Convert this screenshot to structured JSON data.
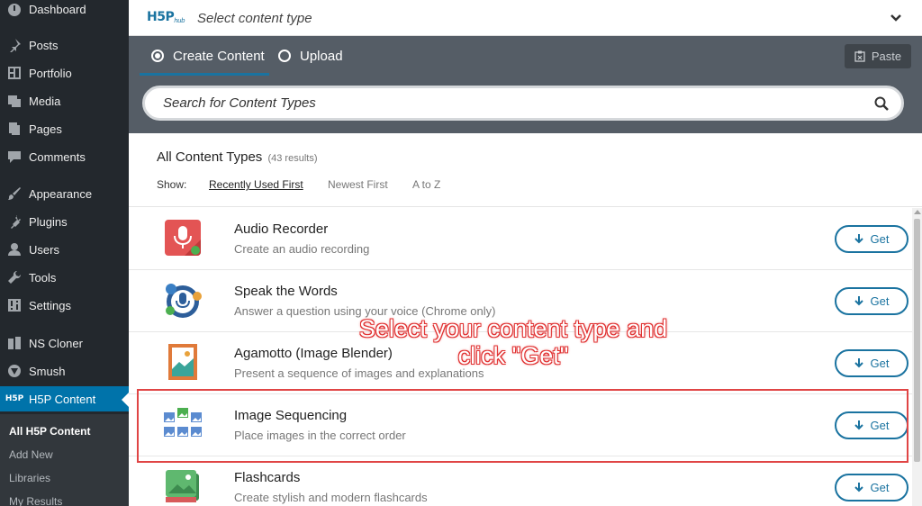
{
  "sidebar": {
    "items": [
      {
        "label": "Dashboard",
        "icon": "dashboard-icon"
      },
      {
        "label": "Posts",
        "icon": "pin-icon"
      },
      {
        "label": "Portfolio",
        "icon": "portfolio-icon"
      },
      {
        "label": "Media",
        "icon": "media-icon"
      },
      {
        "label": "Pages",
        "icon": "pages-icon"
      },
      {
        "label": "Comments",
        "icon": "comment-icon"
      },
      {
        "label": "Appearance",
        "icon": "brush-icon"
      },
      {
        "label": "Plugins",
        "icon": "plug-icon"
      },
      {
        "label": "Users",
        "icon": "user-icon"
      },
      {
        "label": "Tools",
        "icon": "wrench-icon"
      },
      {
        "label": "Settings",
        "icon": "settings-icon"
      },
      {
        "label": "NS Cloner",
        "icon": "cloner-icon"
      },
      {
        "label": "Smush",
        "icon": "smush-icon"
      },
      {
        "label": "H5P Content",
        "icon": "h5p-icon"
      }
    ],
    "submenu": [
      "All H5P Content",
      "Add New",
      "Libraries",
      "My Results"
    ]
  },
  "hub": {
    "logo": "H5P",
    "logo_sub": "hub",
    "title": "Select content type"
  },
  "tabs": {
    "create": "Create Content",
    "upload": "Upload",
    "paste": "Paste"
  },
  "search": {
    "placeholder": "Search for Content Types"
  },
  "filter": {
    "title": "All Content Types",
    "count": "(43 results)",
    "show_label": "Show:",
    "options": [
      "Recently Used First",
      "Newest First",
      "A to Z"
    ]
  },
  "list": [
    {
      "title": "Audio Recorder",
      "desc": "Create an audio recording",
      "button": "Get"
    },
    {
      "title": "Speak the Words",
      "desc": "Answer a question using your voice (Chrome only)",
      "button": "Get"
    },
    {
      "title": "Agamotto (Image Blender)",
      "desc": "Present a sequence of images and explanations",
      "button": "Get"
    },
    {
      "title": "Image Sequencing",
      "desc": "Place images in the correct order",
      "button": "Get"
    },
    {
      "title": "Flashcards",
      "desc": "Create stylish and modern flashcards",
      "button": "Get"
    }
  ],
  "annotation": {
    "line1": "Select your content type and",
    "line2": "click \"Get\""
  },
  "colors": {
    "accent": "#1a73a0",
    "sidebar_bg": "#23282d",
    "active_menu": "#0073aa",
    "tabbar_bg": "#555d66",
    "annotation_red": "#e03030"
  }
}
